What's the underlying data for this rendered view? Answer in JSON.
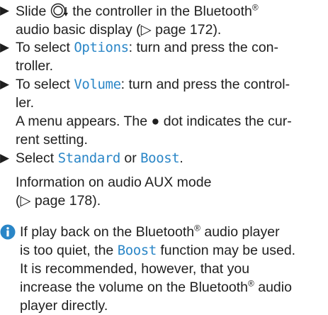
{
  "steps": [
    {
      "t1": "Slide",
      "t2": "the controller in the Bluetooth",
      "sup": "®",
      "t3": "audio basic display (",
      "ref_arrow": "▷",
      "t4": "page 172)."
    },
    {
      "t1": "To select",
      "ui": "Options",
      "t2": ": turn and press the con-",
      "t3": "troller."
    },
    {
      "t1": "To select",
      "ui": "Volume",
      "t2": ": turn and press the control-",
      "t3": "ler.",
      "note1": "A menu appears. The",
      "dot": "●",
      "note2": "dot indicates the cur-",
      "note3": "rent setting."
    },
    {
      "t1": "Select",
      "ui1": "Standard",
      "t2": "or",
      "ui2": "Boost",
      "t3": ".",
      "note1": "Information on audio AUX mode",
      "ref_arrow": "▷",
      "note2": "page 178)."
    }
  ],
  "info": {
    "l1a": "If play back on the Bluetooth",
    "sup": "®",
    "l1b": "audio player",
    "l2a": "is too quiet, the",
    "ui": "Boost",
    "l2b": "function may be used.",
    "l3": "It is recommended, however, that you",
    "l4a": "increase the volume on the Bluetooth",
    "sup2": "®",
    "l4b": "audio",
    "l5": "player directly."
  },
  "colors": {
    "accent": "#2a86c7",
    "text": "#1f1f1f"
  },
  "icons": {
    "bullet": "right-triangle",
    "controller": "controller-slide-down-icon",
    "info": "info-circle-icon"
  }
}
